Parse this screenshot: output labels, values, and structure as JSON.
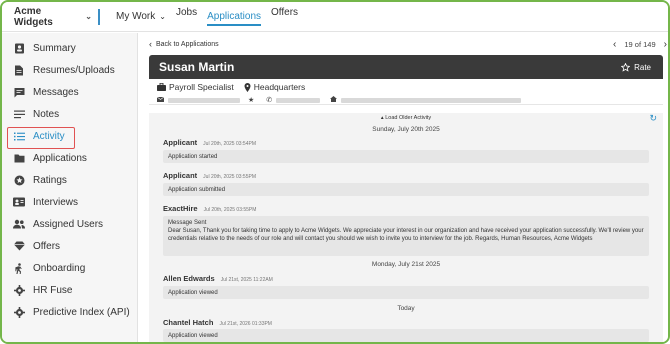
{
  "topbar": {
    "company": "Acme Widgets",
    "nav": {
      "my_work": "My Work",
      "jobs": "Jobs",
      "applications": "Applications",
      "offers": "Offers"
    }
  },
  "sidebar": {
    "items": [
      {
        "label": "Summary",
        "icon": "person-badge-icon"
      },
      {
        "label": "Resumes/Uploads",
        "icon": "document-icon"
      },
      {
        "label": "Messages",
        "icon": "chat-icon"
      },
      {
        "label": "Notes",
        "icon": "lines-icon"
      },
      {
        "label": "Activity",
        "icon": "list-icon",
        "active": true
      },
      {
        "label": "Applications",
        "icon": "folder-icon"
      },
      {
        "label": "Ratings",
        "icon": "star-circle-icon"
      },
      {
        "label": "Interviews",
        "icon": "people-card-icon"
      },
      {
        "label": "Assigned Users",
        "icon": "users-icon"
      },
      {
        "label": "Offers",
        "icon": "diamond-icon"
      },
      {
        "label": "Onboarding",
        "icon": "walking-person-icon"
      },
      {
        "label": "HR Fuse",
        "icon": "gear-icon"
      },
      {
        "label": "Predictive Index (API)",
        "icon": "gear-icon"
      }
    ]
  },
  "main": {
    "back_label": "Back to Applications",
    "pager": "19 of 149",
    "candidate_name": "Susan Martin",
    "rate_label": "Rate",
    "job_title": "Payroll Specialist",
    "location": "Headquarters",
    "load_older": "Load Older Activity",
    "activity": {
      "day1": "Sunday, July 20th 2025",
      "e1_who": "Applicant",
      "e1_when": "Jul 20th, 2025 03:54PM",
      "e1_msg": "Application started",
      "e2_who": "Applicant",
      "e2_when": "Jul 20th, 2025 03:55PM",
      "e2_msg": "Application submitted",
      "e3_who": "ExactHire",
      "e3_when": "Jul 20th, 2025 03:55PM",
      "e3_msg_title": "Message Sent",
      "e3_msg_body": "Dear Susan, Thank you for taking time to apply to Acme Widgets. We appreciate your interest in our organization and have received your application successfully. We'll review your credentials relative to the needs of our role and will contact you should we wish to invite you to interview for the job. Regards, Human Resources, Acme Widgets",
      "day2": "Monday, July 21st 2025",
      "e4_who": "Allen Edwards",
      "e4_when": "Jul 21st, 2025 11:22AM",
      "e4_msg": "Application viewed",
      "day3": "Today",
      "e5_who": "Chantel Hatch",
      "e5_when": "Jul 21st, 2026 01:33PM",
      "e5_msg": "Application viewed"
    }
  },
  "colors": {
    "accent": "#2a8ec5",
    "header_dark": "#3a3a3a",
    "frame": "#74b64a",
    "highlight": "#e05252"
  }
}
